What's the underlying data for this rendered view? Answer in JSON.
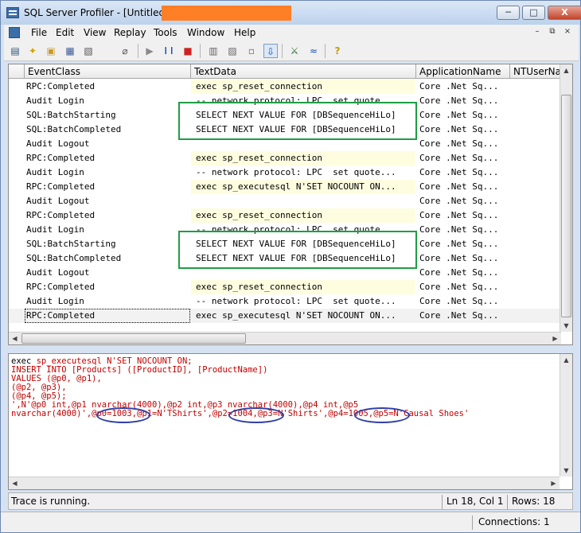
{
  "window": {
    "title": "SQL Server Profiler - [Untitled - 1",
    "minimize": "─",
    "maximize": "□",
    "close": "X"
  },
  "menu": {
    "items": [
      "File",
      "Edit",
      "View",
      "Replay",
      "Tools",
      "Window",
      "Help"
    ],
    "mdi_min": "–",
    "mdi_restore": "⧉",
    "mdi_close": "×"
  },
  "toolbar": {
    "icons": [
      "properties-icon",
      "new-trace-icon",
      "open-icon",
      "save-icon",
      "template-icon",
      "clear-icon",
      "start-icon",
      "pause-icon",
      "stop-icon",
      "find-icon",
      "toggle-icon",
      "columns-icon",
      "scroll-icon",
      "activity-monitor-icon",
      "performance-icon",
      "help-icon"
    ],
    "glyphs": [
      "▤",
      "✦",
      "▣",
      "▦",
      "▧",
      "⌀",
      "▶",
      "❙❙",
      "■",
      "▥",
      "▨",
      "▫",
      "⇩",
      "⚔",
      "≈",
      "?"
    ]
  },
  "grid": {
    "columns": [
      "EventClass",
      "TextData",
      "ApplicationName",
      "NTUserName"
    ],
    "rows": [
      {
        "event": "RPC:Completed",
        "text": "exec sp_reset_connection",
        "app": "Core .Net Sq...",
        "hl": true
      },
      {
        "event": "Audit Login",
        "text": "-- network protocol: LPC  set quote...",
        "app": "Core .Net Sq...",
        "hl": false
      },
      {
        "event": "SQL:BatchStarting",
        "text": "SELECT NEXT VALUE FOR [DBSequenceHiLo]",
        "app": "Core .Net Sq...",
        "hl": false
      },
      {
        "event": "SQL:BatchCompleted",
        "text": "SELECT NEXT VALUE FOR [DBSequenceHiLo]",
        "app": "Core .Net Sq...",
        "hl": false
      },
      {
        "event": "Audit Logout",
        "text": "",
        "app": "Core .Net Sq...",
        "hl": false
      },
      {
        "event": "RPC:Completed",
        "text": "exec sp_reset_connection",
        "app": "Core .Net Sq...",
        "hl": true
      },
      {
        "event": "Audit Login",
        "text": "-- network protocol: LPC  set quote...",
        "app": "Core .Net Sq...",
        "hl": false
      },
      {
        "event": "RPC:Completed",
        "text": "exec sp_executesql N'SET NOCOUNT ON...",
        "app": "Core .Net Sq...",
        "hl": true
      },
      {
        "event": "Audit Logout",
        "text": "",
        "app": "Core .Net Sq...",
        "hl": false
      },
      {
        "event": "RPC:Completed",
        "text": "exec sp_reset_connection",
        "app": "Core .Net Sq...",
        "hl": true
      },
      {
        "event": "Audit Login",
        "text": "-- network protocol: LPC  set quote...",
        "app": "Core .Net Sq...",
        "hl": false
      },
      {
        "event": "SQL:BatchStarting",
        "text": "SELECT NEXT VALUE FOR [DBSequenceHiLo]",
        "app": "Core .Net Sq...",
        "hl": false
      },
      {
        "event": "SQL:BatchCompleted",
        "text": "SELECT NEXT VALUE FOR [DBSequenceHiLo]",
        "app": "Core .Net Sq...",
        "hl": false
      },
      {
        "event": "Audit Logout",
        "text": "",
        "app": "Core .Net Sq...",
        "hl": false
      },
      {
        "event": "RPC:Completed",
        "text": "exec sp_reset_connection",
        "app": "Core .Net Sq...",
        "hl": true
      },
      {
        "event": "Audit Login",
        "text": "-- network protocol: LPC  set quote...",
        "app": "Core .Net Sq...",
        "hl": false
      },
      {
        "event": "RPC:Completed",
        "text": "exec sp_executesql N'SET NOCOUNT ON...",
        "app": "Core .Net Sq...",
        "hl": false,
        "selected": true
      }
    ]
  },
  "sql_text": {
    "line1a": "exec ",
    "line1b": "sp_executesql",
    "line1c": " N'SET NOCOUNT ON;",
    "line2": "INSERT INTO [Products] ([ProductID], [ProductName])",
    "line3": "VALUES (@p0, @p1),",
    "line4": "(@p2, @p3),",
    "line5": "(@p4, @p5);",
    "line6": "',N'@p0 int,@p1 nvarchar(4000),@p2 int,@p3 nvarchar(4000),@p4 int,@p5",
    "line7a": "nvarchar(4000)',",
    "line7b": "@p0=1003",
    "line7c": ",@p1=N'TShirts',",
    "line7d": "@p2=1004",
    "line7e": ",@p3=N'Shirts',",
    "line7f": "@p4=1005",
    "line7g": ",@p5=N'Causal Shoes'"
  },
  "status": {
    "message": "Trace is running.",
    "position": "Ln 18, Col 1",
    "rows": "Rows: 18",
    "connections": "Connections: 1"
  }
}
